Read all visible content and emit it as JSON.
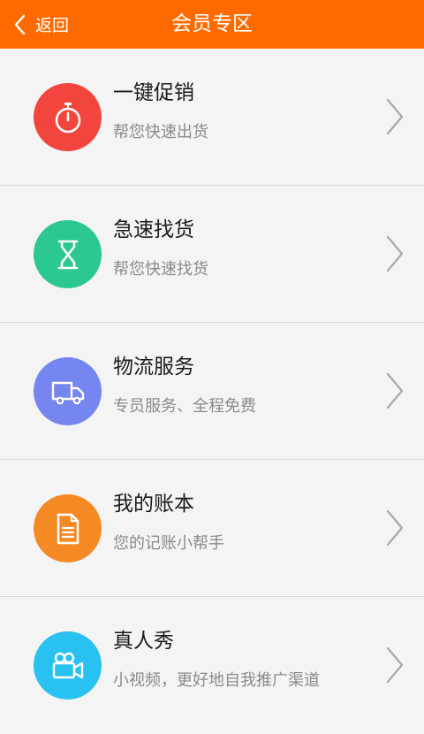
{
  "header": {
    "back_label": "返回",
    "title": "会员专区",
    "color": "#ff6a00"
  },
  "items": [
    {
      "title": "一键促销",
      "subtitle": "帮您快速出货",
      "icon": "stopwatch-icon",
      "color": "#f2453d"
    },
    {
      "title": "急速找货",
      "subtitle": "帮您快速找货",
      "icon": "hourglass-icon",
      "color": "#2bc88f"
    },
    {
      "title": "物流服务",
      "subtitle": "专员服务、全程免费",
      "icon": "truck-icon",
      "color": "#7686f0"
    },
    {
      "title": "我的账本",
      "subtitle": "您的记账小帮手",
      "icon": "document-icon",
      "color": "#f58a25"
    },
    {
      "title": "真人秀",
      "subtitle": "小视频，更好地自我推广渠道",
      "icon": "video-camera-icon",
      "color": "#29c2f0"
    }
  ]
}
